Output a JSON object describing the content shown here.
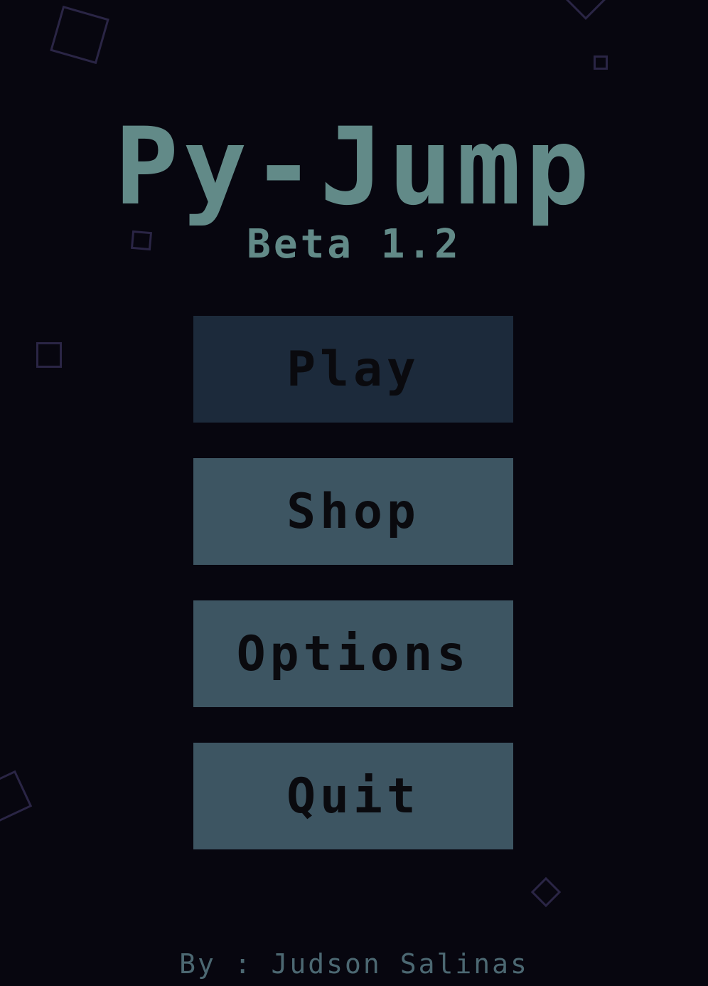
{
  "game": {
    "title": "Py-Jump",
    "version": "Beta 1.2",
    "credit": "By : Judson Salinas"
  },
  "menu": {
    "items": [
      {
        "label": "Play",
        "state": "selected"
      },
      {
        "label": "Shop",
        "state": "normal"
      },
      {
        "label": "Options",
        "state": "normal"
      },
      {
        "label": "Quit",
        "state": "normal"
      }
    ]
  },
  "colors": {
    "background": "#07060f",
    "title": "#628a88",
    "button_normal": "#3d5562",
    "button_selected": "#1c2a3b",
    "button_text": "#0a0a0e",
    "credit": "#4c6872",
    "decoration_outline": "#2a2545"
  },
  "decorations": [
    {
      "shape": "square-outline"
    },
    {
      "shape": "square-outline"
    },
    {
      "shape": "square-outline"
    },
    {
      "shape": "square-outline"
    },
    {
      "shape": "square-outline"
    },
    {
      "shape": "square-outline"
    },
    {
      "shape": "square-outline"
    }
  ]
}
